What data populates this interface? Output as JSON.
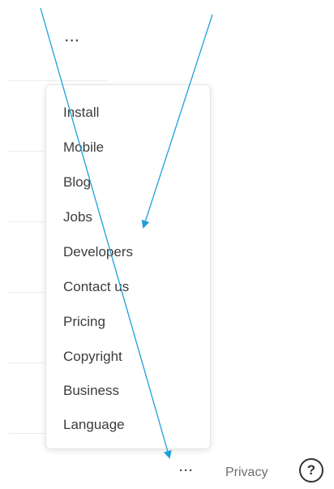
{
  "top_more_label": "···",
  "menu": {
    "items": [
      {
        "label": "Install"
      },
      {
        "label": "Mobile"
      },
      {
        "label": "Blog"
      },
      {
        "label": "Jobs"
      },
      {
        "label": "Developers"
      },
      {
        "label": "Contact us"
      },
      {
        "label": "Pricing"
      },
      {
        "label": "Copyright"
      },
      {
        "label": "Business"
      },
      {
        "label": "Language"
      }
    ]
  },
  "footer": {
    "more_label": "···",
    "privacy_label": "Privacy",
    "help_label": "?"
  },
  "colors": {
    "arrow": "#1e9fd8",
    "text": "#3c3c3c"
  }
}
